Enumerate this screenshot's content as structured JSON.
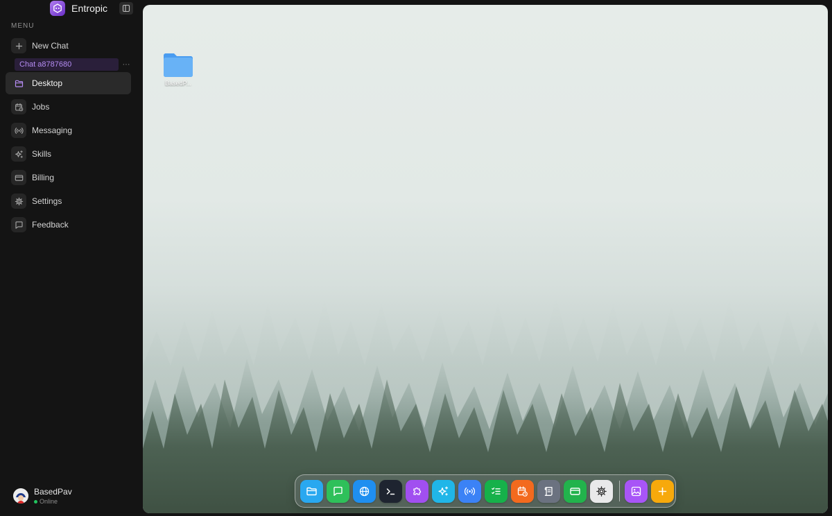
{
  "brand": {
    "name": "Entropic",
    "accent": "#9b5de5"
  },
  "sidebar": {
    "menu_heading": "MENU",
    "new_chat_label": "New Chat",
    "chat_item": {
      "label": "Chat a8787680",
      "more_label": "···"
    },
    "items": [
      {
        "label": "Desktop",
        "icon": "folder-icon",
        "active": true
      },
      {
        "label": "Jobs",
        "icon": "calendar-clock-icon"
      },
      {
        "label": "Messaging",
        "icon": "broadcast-icon"
      },
      {
        "label": "Skills",
        "icon": "sparkles-icon"
      },
      {
        "label": "Billing",
        "icon": "credit-card-icon"
      },
      {
        "label": "Settings",
        "icon": "gear-icon"
      },
      {
        "label": "Feedback",
        "icon": "message-square-icon"
      }
    ]
  },
  "user": {
    "name": "BasedPav",
    "status": "Online",
    "status_color": "#22c55e"
  },
  "desktop": {
    "folder": {
      "label": "BasedP..."
    }
  },
  "dock": {
    "apps": [
      {
        "name": "files",
        "icon": "folder-icon",
        "color": "#29a8f0"
      },
      {
        "name": "chat",
        "icon": "chat-icon",
        "color": "#2fc05a"
      },
      {
        "name": "browser",
        "icon": "globe-icon",
        "color": "#1f8ff0"
      },
      {
        "name": "terminal",
        "icon": "terminal-icon",
        "color": "#1e2430"
      },
      {
        "name": "plugins",
        "icon": "puzzle-icon",
        "color": "#a14ff0"
      },
      {
        "name": "skills",
        "icon": "sparkles-icon",
        "color": "#20b6e8"
      },
      {
        "name": "messaging",
        "icon": "broadcast-icon",
        "color": "#3b82f6"
      },
      {
        "name": "tasks",
        "icon": "checklist-icon",
        "color": "#16b14a"
      },
      {
        "name": "jobs",
        "icon": "calendar-clock-icon",
        "color": "#f36a1e"
      },
      {
        "name": "logs",
        "icon": "scroll-icon",
        "color": "#6b7280"
      },
      {
        "name": "billing",
        "icon": "credit-card-icon",
        "color": "#22b34c"
      },
      {
        "name": "settings",
        "icon": "gear-icon",
        "color": "#e9e9ea"
      },
      {
        "name": "gallery",
        "icon": "image-icon",
        "color": "#a855f7"
      },
      {
        "name": "add",
        "icon": "plus-icon",
        "color": "#f7a90c"
      }
    ]
  }
}
